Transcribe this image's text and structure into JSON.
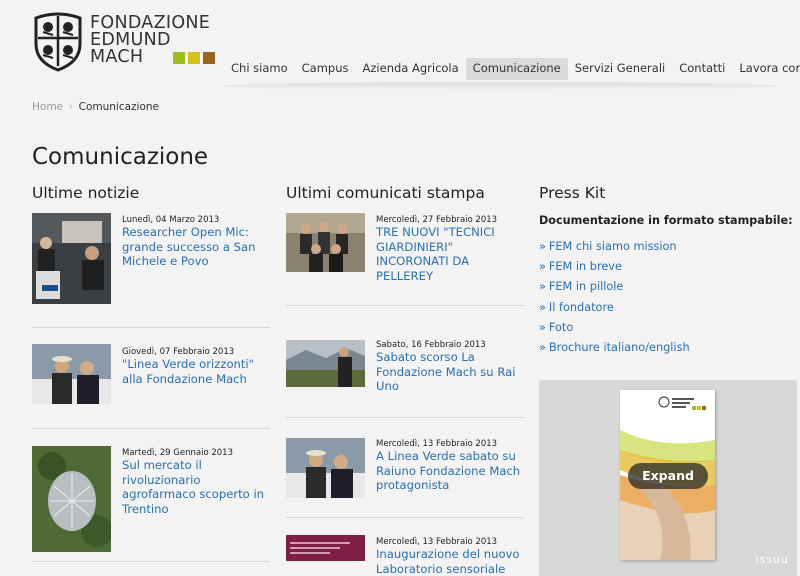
{
  "header": {
    "logo_lines": [
      "FONDAZIONE",
      "EDMUND",
      "MACH"
    ],
    "logo_squares": [
      "#9cbd1c",
      "#d4c21a",
      "#9a6420"
    ],
    "nav": [
      {
        "label": "Chi siamo",
        "active": false
      },
      {
        "label": "Campus",
        "active": false
      },
      {
        "label": "Azienda Agricola",
        "active": false
      },
      {
        "label": "Comunicazione",
        "active": true
      },
      {
        "label": "Servizi Generali",
        "active": false
      },
      {
        "label": "Contatti",
        "active": false
      },
      {
        "label": "Lavora con noi",
        "active": false
      }
    ]
  },
  "breadcrumb": {
    "home": "Home",
    "separator": "›",
    "current": "Comunicazione"
  },
  "page_title": "Comunicazione",
  "news": {
    "heading": "Ultime notizie",
    "items": [
      {
        "date": "Lunedì, 04 Marzo 2013",
        "title": "Researcher Open Mic: grande successo a San Michele e Povo",
        "thumb": "people-at-event"
      },
      {
        "date": "Giovedì, 07 Febbraio 2013",
        "title": "\"Linea Verde orizzonti\" alla Fondazione Mach",
        "thumb": "two-men-winter"
      },
      {
        "date": "Martedì, 29 Gennaio 2013",
        "title": "Sul mercato il rivoluzionario agrofarmaco scoperto in Trentino",
        "thumb": "net-covered-plant"
      }
    ]
  },
  "press": {
    "heading": "Ultimi comunicati stampa",
    "items": [
      {
        "date": "Mercoledì, 27 Febbraio 2013",
        "title": "TRE NUOVI \"TECNICI GIARDINIERI\" INCORONATI DA PELLEREY",
        "thumb": "group-photo"
      },
      {
        "date": "Sabato, 16 Febbraio 2013",
        "title": "Sabato scorso La Fondazione Mach su Rai Uno",
        "thumb": "man-in-vineyard"
      },
      {
        "date": "Mercoledì, 13 Febbraio 2013",
        "title": "A Linea Verde sabato su Raiuno Fondazione Mach protagonista",
        "thumb": "two-men-winter"
      },
      {
        "date": "Mercoledì, 13 Febbraio 2013",
        "title": "Inaugurazione del nuovo Laboratorio sensoriale",
        "thumb": "event-banner"
      }
    ]
  },
  "presskit": {
    "heading": "Press Kit",
    "subheading": "Documentazione in formato stampabile:",
    "bullet": "»",
    "links": [
      "FEM chi siamo mission",
      "FEM in breve",
      "FEM in pillole",
      "Il fondatore",
      "Foto",
      "Brochure italiano/english"
    ],
    "viewer": {
      "expand_label": "Expand",
      "brand": "issuu"
    }
  }
}
